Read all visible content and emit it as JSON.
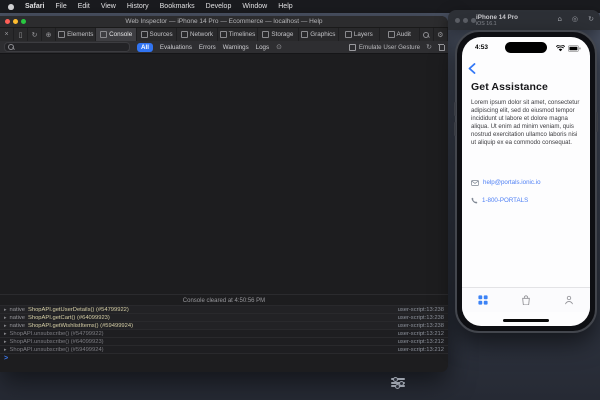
{
  "menu_bar": {
    "items": [
      "Safari",
      "File",
      "Edit",
      "View",
      "History",
      "Bookmarks",
      "Develop",
      "Window",
      "Help"
    ]
  },
  "inspector": {
    "title": "Web Inspector — iPhone 14 Pro — Ecommerce — localhost — Help",
    "tabs": [
      {
        "label": "Elements"
      },
      {
        "label": "Console"
      },
      {
        "label": "Sources"
      },
      {
        "label": "Network"
      },
      {
        "label": "Timelines"
      },
      {
        "label": "Storage"
      },
      {
        "label": "Graphics"
      },
      {
        "label": "Layers"
      },
      {
        "label": "Audit"
      }
    ],
    "selected_tab": "Console",
    "filter_bar": {
      "scopes": [
        "All",
        "Evaluations",
        "Errors",
        "Warnings",
        "Logs"
      ],
      "selected_scope": "All",
      "emulate_label": "Emulate User Gesture"
    },
    "cleared_message": "Console cleared at 4:50:56 PM",
    "logs": [
      {
        "tag": "native",
        "text": "ShopAPI.getUserDetails() (#54799922)",
        "location": "user-script:13:238"
      },
      {
        "tag": "native",
        "text": "ShopAPI.getCart() (#64099923)",
        "location": "user-script:13:238"
      },
      {
        "tag": "native",
        "text": "ShopAPI.getWishlistItems() (#59499924)",
        "location": "user-script:13:238"
      },
      {
        "tag": "",
        "text": "ShopAPI.unsubscribe() (#54799922)",
        "location": "user-script:13:212"
      },
      {
        "tag": "",
        "text": "ShopAPI.unsubscribe() (#64099923)",
        "location": "user-script:13:212"
      },
      {
        "tag": "",
        "text": "ShopAPI.unsubscribe() (#59499924)",
        "location": "user-script:13:212"
      }
    ],
    "prompt": ">"
  },
  "simulator": {
    "title": "iPhone 14 Pro",
    "subtitle": "iOS 16.1"
  },
  "phone": {
    "status_time": "4:53",
    "title": "Get Assistance",
    "body": "Lorem ipsum dolor sit amet, consectetur adipiscing elit, sed do eiusmod tempor incididunt ut labore et dolore magna aliqua. Ut enim ad minim veniam, quis nostrud exercitation ullamco laboris nisi ut aliquip ex ea commodo consequat.",
    "email_link": "help@portals.ionic.io",
    "phone_link": "1-800-PORTALS"
  },
  "colors": {
    "accent_blue": "#3174f1",
    "ios_link_blue": "#4f80f5",
    "log_text": "#d6cfa6"
  }
}
